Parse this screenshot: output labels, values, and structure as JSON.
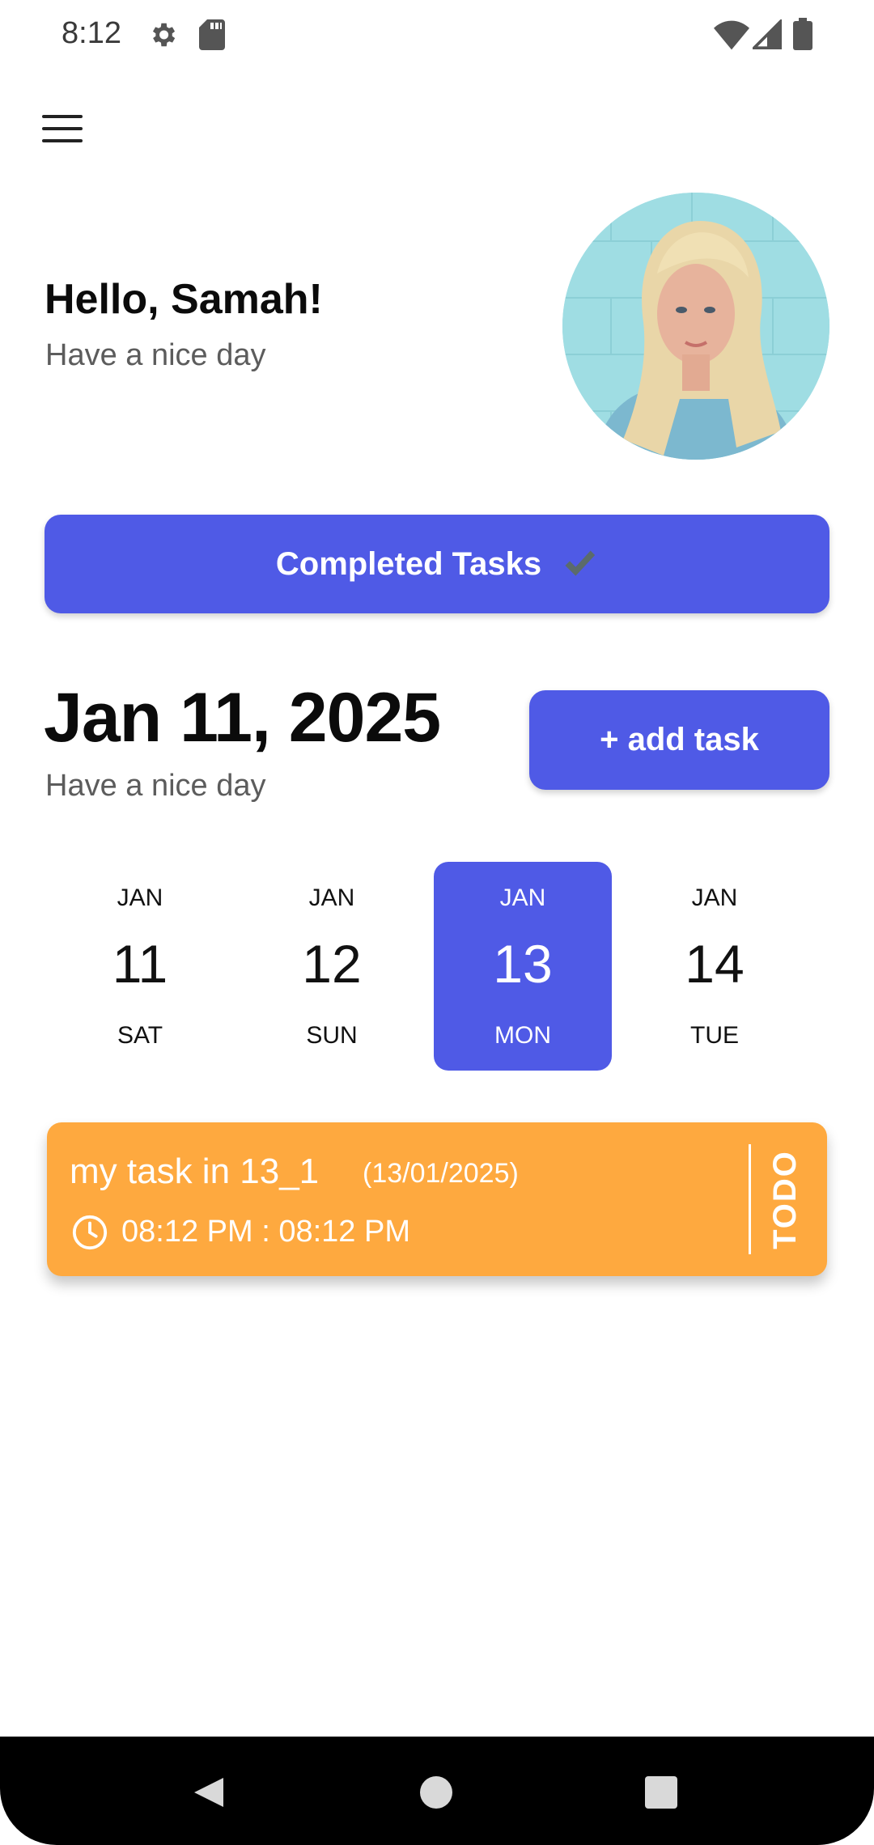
{
  "status_bar": {
    "time": "8:12",
    "icons": [
      "gear-icon",
      "sd-card-icon",
      "wifi-icon",
      "signal-icon",
      "battery-icon"
    ]
  },
  "header": {
    "menu_icon": "hamburger-menu-icon"
  },
  "greeting": {
    "title": "Hello, Samah!",
    "subtitle": "Have a nice day"
  },
  "completed_tasks": {
    "label": "Completed Tasks",
    "icon": "check-mark-icon"
  },
  "date_header": {
    "date": "Jan 11, 2025",
    "subtitle": "Have a nice day",
    "add_task_label": "+ add task"
  },
  "date_strip": [
    {
      "month": "JAN",
      "day": "11",
      "weekday": "SAT",
      "selected": false
    },
    {
      "month": "JAN",
      "day": "12",
      "weekday": "SUN",
      "selected": false
    },
    {
      "month": "JAN",
      "day": "13",
      "weekday": "MON",
      "selected": true
    },
    {
      "month": "JAN",
      "day": "14",
      "weekday": "TUE",
      "selected": false
    }
  ],
  "tasks": [
    {
      "title": "my task in 13_1",
      "date": "(13/01/2025)",
      "time": "08:12 PM : 08:12 PM",
      "status": "TODO",
      "color": "#fea93f"
    }
  ],
  "colors": {
    "accent": "#4f5ae6",
    "task_card": "#fea93f"
  },
  "nav_bar": {
    "icons": [
      "back-icon",
      "home-icon",
      "recents-icon"
    ]
  }
}
